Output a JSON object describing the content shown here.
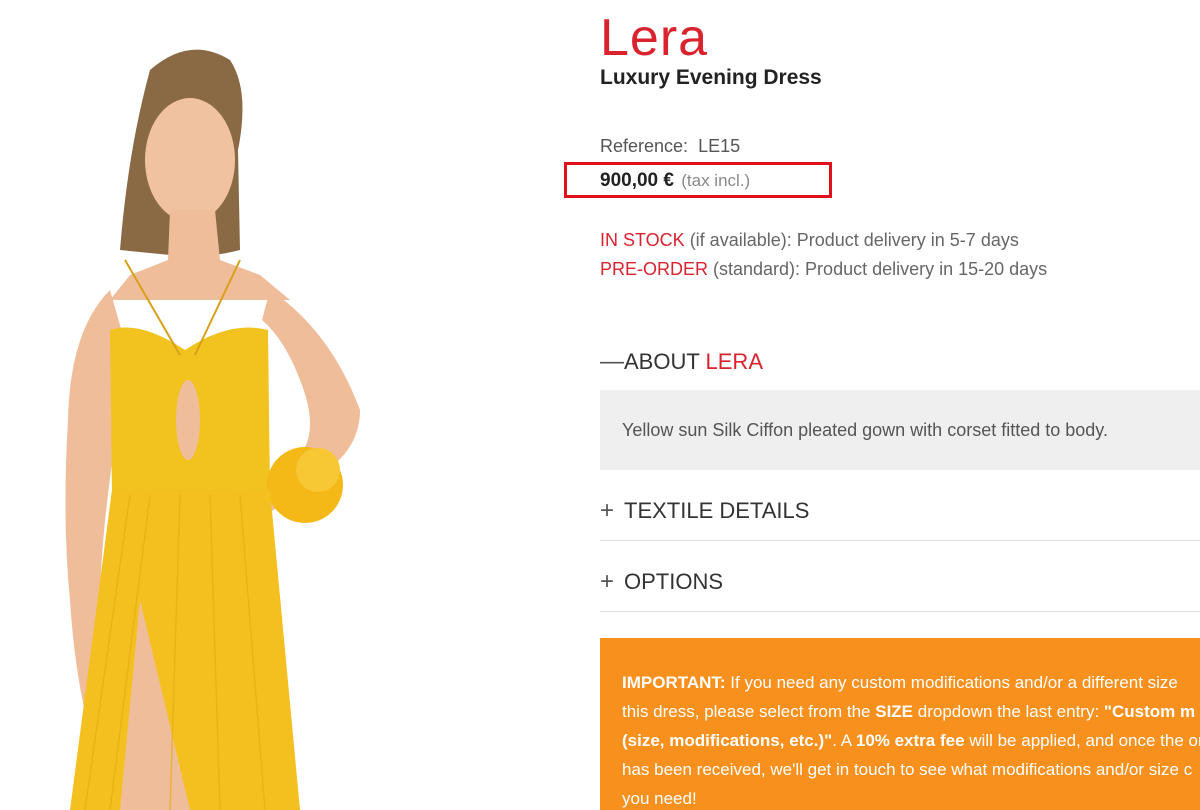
{
  "product": {
    "brand": "Lera",
    "subtitle": "Luxury Evening Dress",
    "reference_label": "Reference:",
    "reference_value": "LE15",
    "price": "900,00 €",
    "tax_note": "(tax incl.)",
    "highlight_color": "#e0101d"
  },
  "stock": {
    "in_stock_label": "IN STOCK",
    "in_stock_text": " (if available): Product delivery in 5-7 days",
    "preorder_label": "PRE-ORDER",
    "preorder_text": " (standard): Product delivery in 15-20 days"
  },
  "accordion": {
    "about_sign": "—",
    "about_prefix": "ABOUT ",
    "about_name": "LERA",
    "about_body": "Yellow sun Silk Ciffon pleated gown with corset fitted to body.",
    "textile_sign": "+",
    "textile_label": "TEXTILE DETAILS",
    "options_sign": "+",
    "options_label": "OPTIONS"
  },
  "notice": {
    "l1_bold": "IMPORTANT:",
    "l1_text": " If you need any custom modifications and/or a different size",
    "l2_text": "this dress, please select from the ",
    "l2_bold1": "SIZE",
    "l2_text2": " dropdown the last entry: ",
    "l2_bold2": "\"Custom m",
    "l3_bold": "(size, modifications, etc.)\"",
    "l3_text": ". A ",
    "l3_bold2": "10% extra fee",
    "l3_text2": " will be applied, and once the ord",
    "l4_text": "has been received, we'll get in touch to see what modifications and/or size c",
    "l5_text": "you need!",
    "background": "#f8901d"
  },
  "colors": {
    "accent_red": "#d9232f",
    "dress_yellow": "#f4c020"
  }
}
